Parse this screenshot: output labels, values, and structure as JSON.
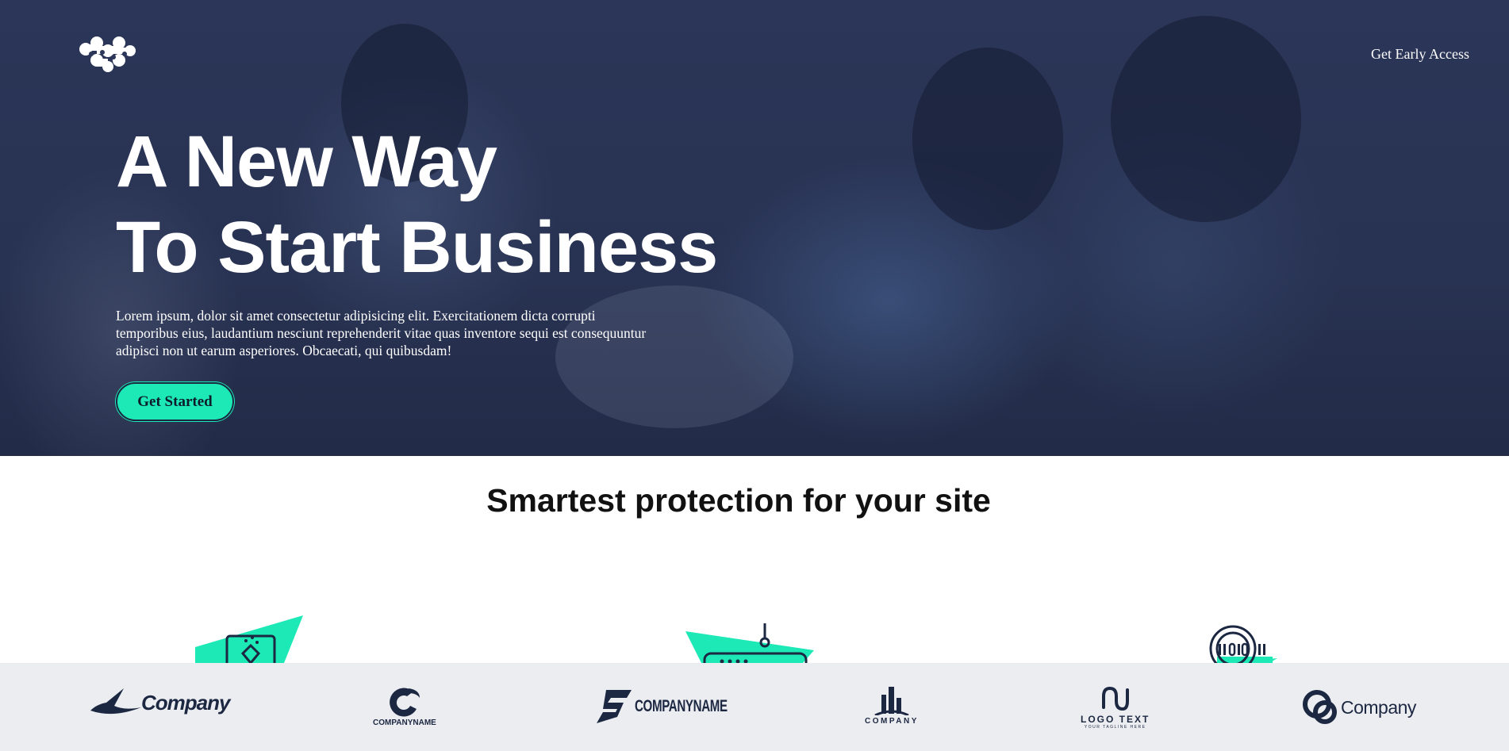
{
  "header": {
    "logo_icon": "molecule-logo-icon",
    "nav_link": "Get Early Access"
  },
  "hero": {
    "title_line1": "A New Way",
    "title_line2": "To Start Business",
    "description": "Lorem ipsum, dolor sit amet consectetur adipisicing elit. Exercitationem dicta corrupti temporibus eius, laudantium nesciunt reprehenderit vitae quas inventore sequi est consequuntur adipisci non ut earum asperiores. Obcaecati, qui quibusdam!",
    "cta_label": "Get Started"
  },
  "features": {
    "title": "Smartest protection for your site",
    "icons": [
      "laptop-shield-icon",
      "router-icon",
      "fingerprint-icon"
    ]
  },
  "brands": [
    {
      "icon": "witch-hat-icon",
      "text": "Company"
    },
    {
      "icon": "c-swirl-icon",
      "text": "COMPANYNAME"
    },
    {
      "icon": "s-slash-icon",
      "text": "COMPANYNAME"
    },
    {
      "icon": "buildings-icon",
      "text": "COMPANY"
    },
    {
      "icon": "wave-loop-icon",
      "text": "LOGO TEXT",
      "tagline": "YOUR TAGLINE HERE"
    },
    {
      "icon": "linked-rings-icon",
      "text": "Company"
    }
  ],
  "colors": {
    "hero_overlay": "#2b3658",
    "accent": "#1de9b6",
    "dark_navy": "#1c2742",
    "logo_bar_bg": "#ebedf0"
  }
}
